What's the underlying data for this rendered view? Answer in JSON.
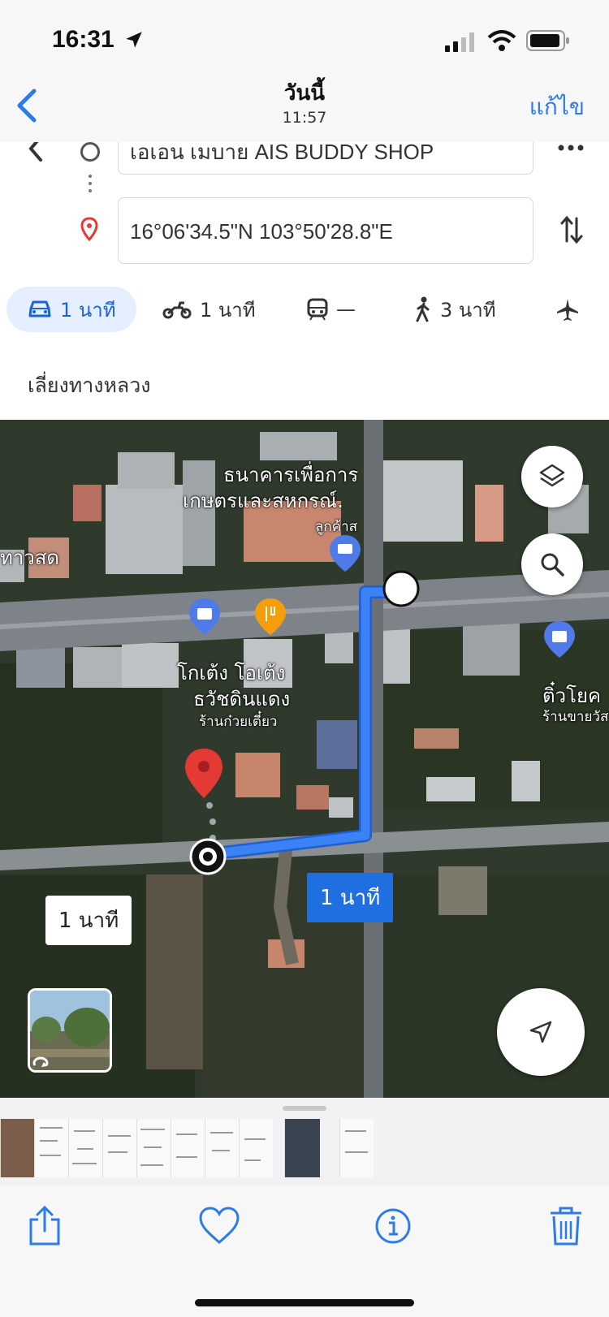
{
  "status_bar": {
    "time": "16:31",
    "icons": [
      "location-arrow-icon",
      "cellular-signal-icon",
      "wifi-icon",
      "battery-icon"
    ]
  },
  "photo_nav": {
    "title": "วันนี้",
    "subtitle": "11:57",
    "edit_label": "แก้ไข"
  },
  "directions": {
    "origin": "เอเอน เมบาย AIS BUDDY SHOP",
    "destination": "16°06'34.5\"N 103°50'28.8\"E",
    "modes": [
      {
        "icon": "car-icon",
        "label": "1 นาที",
        "selected": true
      },
      {
        "icon": "motorcycle-icon",
        "label": "1 นาที"
      },
      {
        "icon": "transit-icon",
        "label": "—"
      },
      {
        "icon": "walk-icon",
        "label": "3 นาที"
      },
      {
        "icon": "flight-icon",
        "label": ""
      }
    ],
    "route_summary": "เลี่ยงทางหลวง"
  },
  "map": {
    "labels": {
      "bank_line1": "ธนาคารเพื่อการ",
      "bank_line2": "เกษตรและสหกรณ์.",
      "bank_short": "ลูกค้าส",
      "left_edge": "ทาวสด",
      "shop_line1": "โกเต้ง โอเต้ง",
      "shop_line2": "ธวัชดินแดง",
      "shop_line3": "ร้านก๋วยเตี๋ยว",
      "right_shop_line1": "ติ๋วโยค",
      "right_shop_line2": "ร้านขายวัส"
    },
    "route_duration": "1 นาที",
    "alt_duration": "1 นาที",
    "colors": {
      "route": "#3b82f6",
      "pin": "#e53935",
      "label_blue": "#1f6fe0"
    }
  },
  "toolbar": {
    "icons": [
      "share-icon",
      "heart-icon",
      "info-icon",
      "trash-icon"
    ]
  }
}
